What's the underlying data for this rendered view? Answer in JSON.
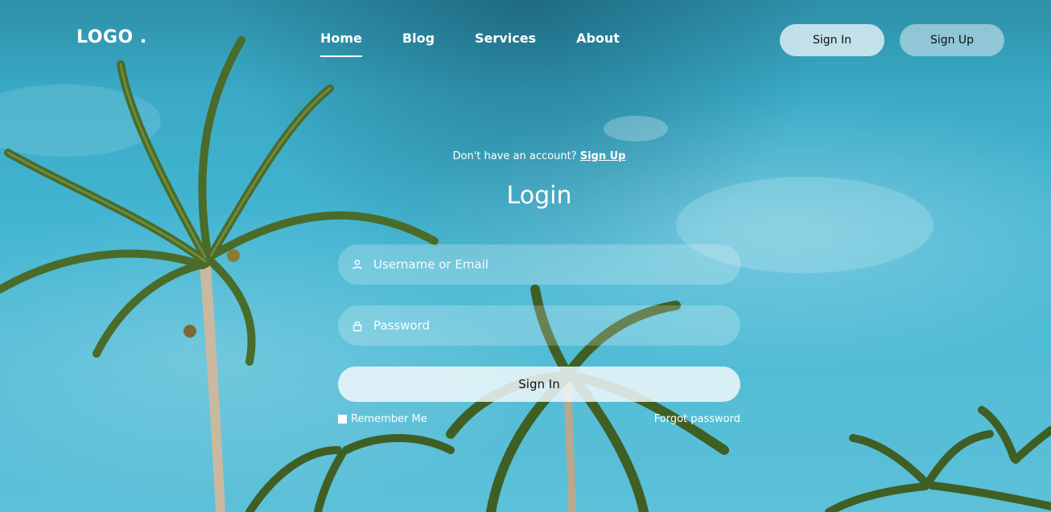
{
  "nav": {
    "logo": "LOGO .",
    "links": [
      {
        "label": "Home",
        "active": true
      },
      {
        "label": "Blog",
        "active": false
      },
      {
        "label": "Services",
        "active": false
      },
      {
        "label": "About",
        "active": false
      }
    ],
    "sign_in_label": "Sign In",
    "sign_up_label": "Sign Up"
  },
  "login": {
    "hint_text": "Don't have an account?",
    "hint_link": "Sign Up",
    "title": "Login",
    "username_placeholder": "Username or Email",
    "username_icon": "user-icon",
    "password_placeholder": "Password",
    "password_icon": "lock-icon",
    "submit_label": "Sign In",
    "remember_label": "Remember Me",
    "forgot_label": "Forgot password"
  },
  "colors": {
    "sky": "#44b6d2",
    "button_light": "#ebf5f8",
    "palm_green": "#4a6b2a"
  }
}
